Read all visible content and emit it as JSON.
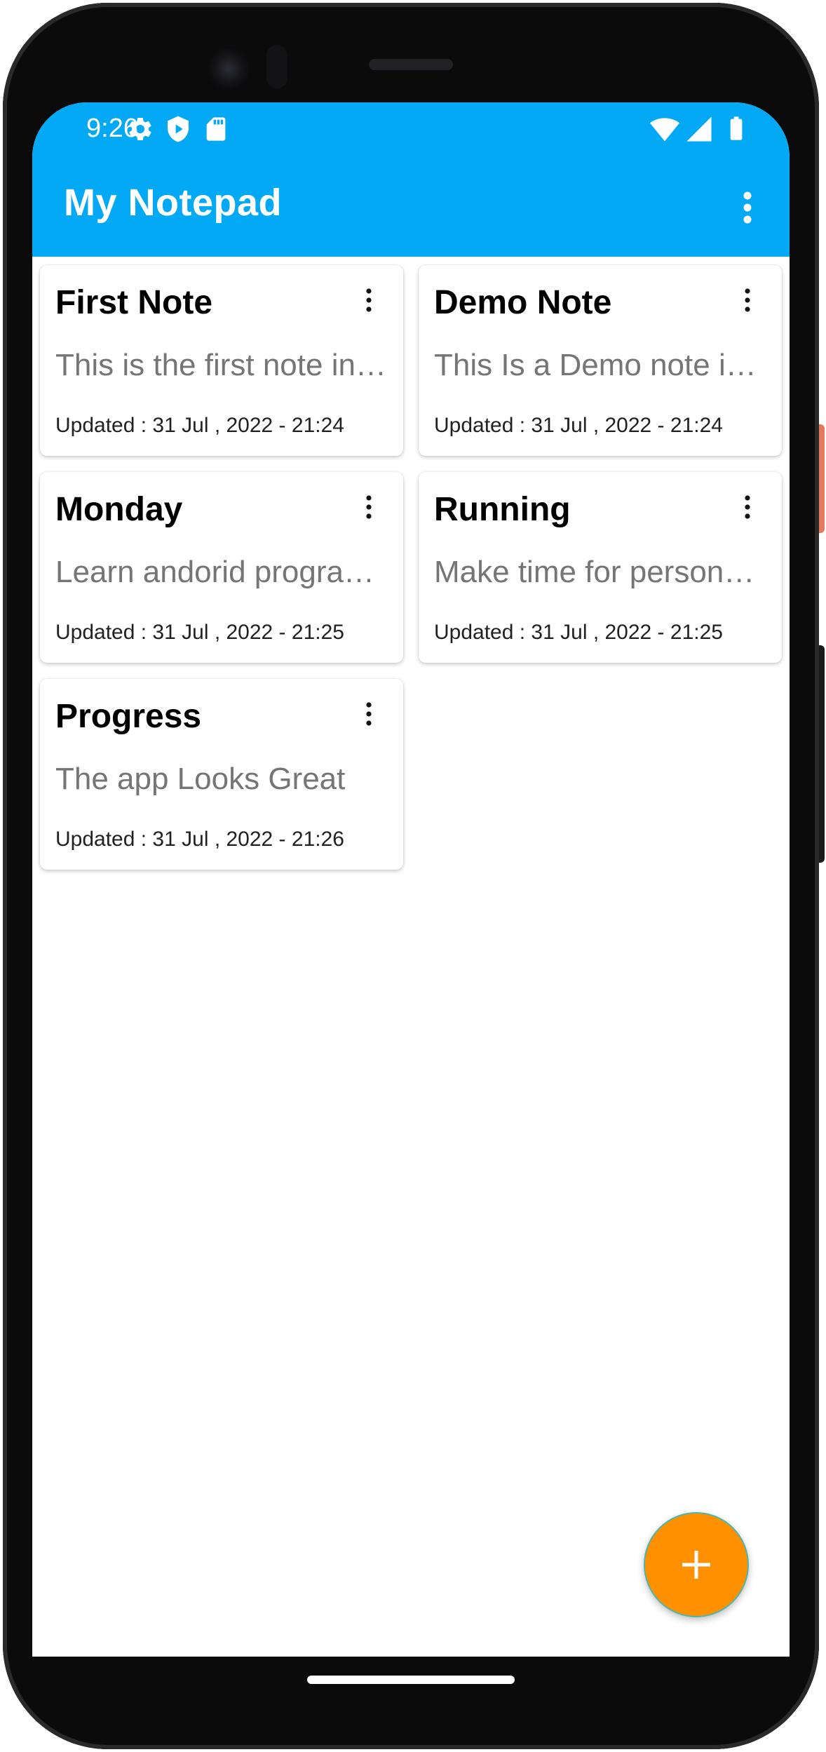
{
  "status_bar": {
    "time": "9:26",
    "left_icons": [
      "settings-icon",
      "shield-play-icon",
      "sd-card-icon"
    ],
    "right_icons": [
      "wifi-icon",
      "cell-signal-icon",
      "battery-icon"
    ]
  },
  "toolbar": {
    "title": "My Notepad",
    "menu_icon": "more-vert-icon"
  },
  "notes": [
    {
      "title": "First Note",
      "body": "This is the first note in …",
      "updated": "Updated : 31 Jul , 2022 - 21:24"
    },
    {
      "title": "Demo Note",
      "body": "This Is a Demo note in…",
      "updated": "Updated : 31 Jul , 2022 - 21:24"
    },
    {
      "title": "Monday",
      "body": "Learn andorid progra…",
      "updated": "Updated : 31 Jul , 2022 - 21:25"
    },
    {
      "title": "Running",
      "body": "Make time for persona…",
      "updated": "Updated : 31 Jul , 2022 - 21:25"
    },
    {
      "title": "Progress",
      "body": "The app Looks Great",
      "updated": "Updated : 31 Jul , 2022 - 21:26"
    }
  ],
  "fab": {
    "icon": "plus-icon"
  },
  "colors": {
    "app_bar": "#03a9f4",
    "fab": "#ff9100",
    "note_body": "#757575"
  }
}
